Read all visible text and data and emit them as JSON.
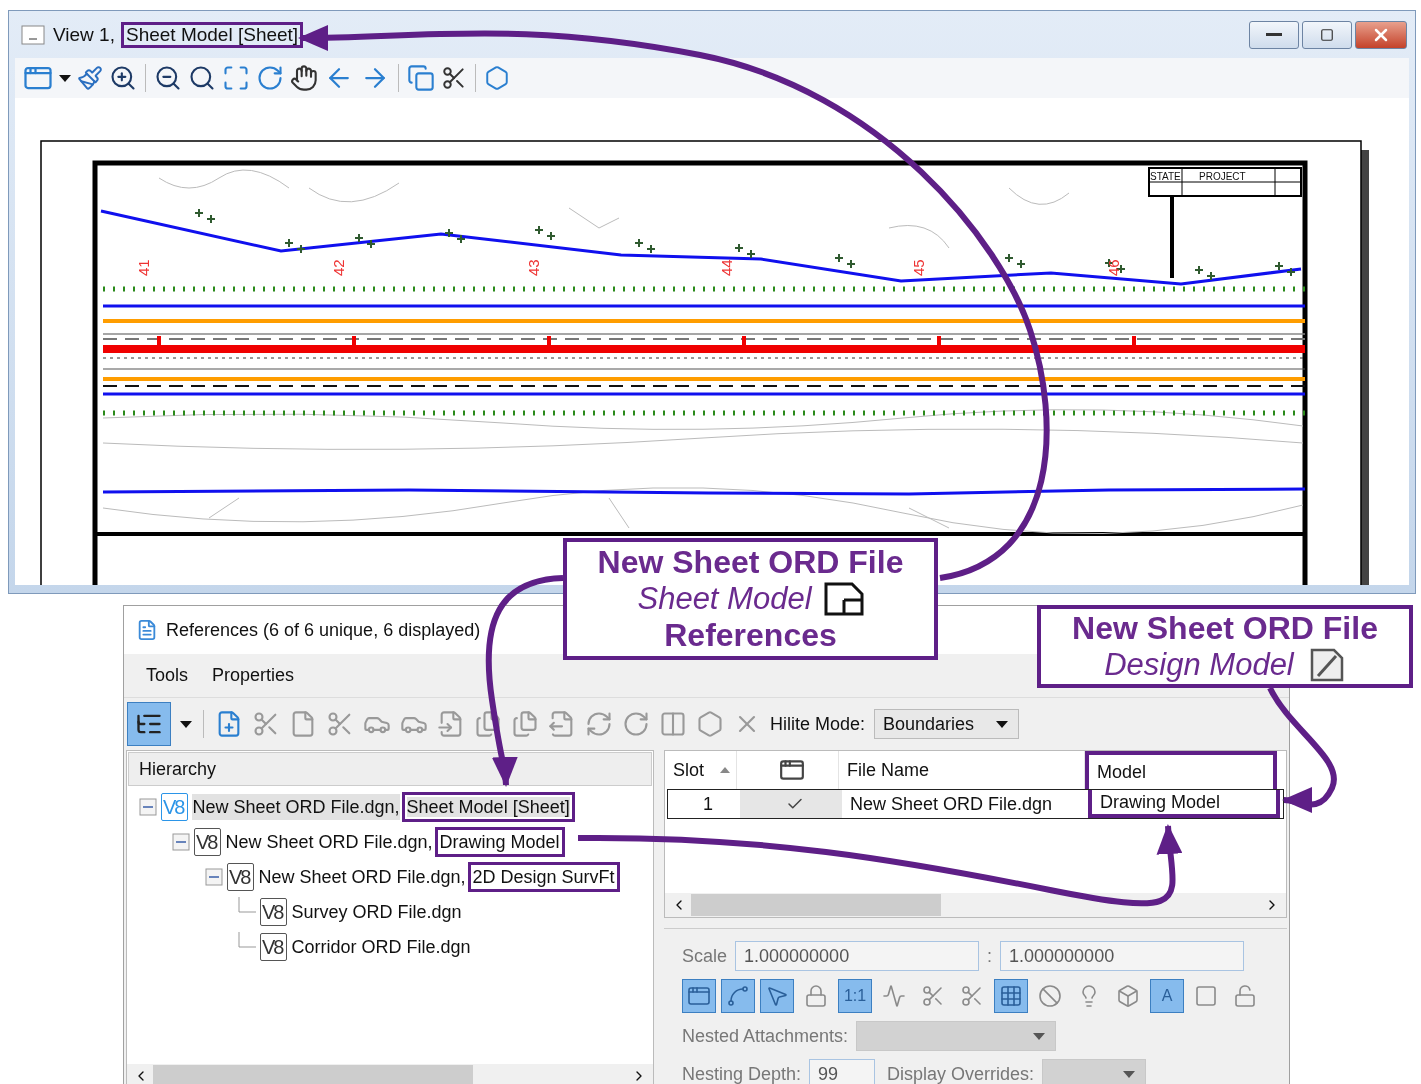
{
  "view_window": {
    "title": "View 1,",
    "title_model": "Sheet Model [Sheet]",
    "title_model_annotated": true,
    "sheet": {
      "stations": [
        "41",
        "42",
        "43",
        "44",
        "45",
        "46"
      ],
      "title_block": [
        "STATE",
        "PROJECT"
      ]
    }
  },
  "callouts": [
    {
      "kind": "sheet",
      "file": "New Sheet ORD File",
      "model": "Sheet Model",
      "caption": "References"
    },
    {
      "kind": "design",
      "file": "New Sheet ORD File",
      "model": "Design Model"
    }
  ],
  "references": {
    "title": "References (6 of 6 unique, 6 displayed)",
    "menu": [
      "Tools",
      "Properties"
    ],
    "view_toggle": {
      "on": true
    },
    "hilite_mode": {
      "label": "Hilite Mode:",
      "value": "Boundaries"
    },
    "hierarchy": {
      "heading": "Hierarchy",
      "tree": [
        {
          "format": "V8",
          "file": "New Sheet ORD File.dgn,",
          "model": "Sheet Model [Sheet]",
          "annotated": true,
          "selected": true,
          "expanded": true,
          "children": [
            {
              "format": "V8",
              "file": "New Sheet ORD File.dgn,",
              "model": "Drawing Model",
              "annotated": true,
              "selected": false,
              "expanded": true,
              "children": [
                {
                  "format": "V8",
                  "file": "New Sheet ORD File.dgn,",
                  "model": "2D Design SurvFt",
                  "annotated": true,
                  "selected": false,
                  "expanded": true,
                  "children": [
                    {
                      "format": "V8",
                      "file": "Survey ORD File.dgn",
                      "selected": false
                    },
                    {
                      "format": "V8",
                      "file": "Corridor ORD File.dgn",
                      "selected": false
                    }
                  ]
                }
              ]
            }
          ]
        }
      ]
    },
    "table": {
      "columns": [
        {
          "kind": "text",
          "label": "Slot",
          "sorted": true,
          "annotated": false
        },
        {
          "kind": "icon",
          "sorted": false,
          "annotated": false
        },
        {
          "kind": "text",
          "label": "File Name",
          "sorted": false,
          "annotated": false
        },
        {
          "kind": "text",
          "label": "Model",
          "sorted": false,
          "annotated": true
        }
      ],
      "rows": [
        {
          "slot": "1",
          "displayed": true,
          "file": "New Sheet ORD File.dgn",
          "model": "Drawing Model"
        }
      ]
    },
    "scale": {
      "label": "Scale",
      "separator": ":",
      "values": [
        "1.000000000",
        "1.000000000"
      ]
    },
    "display_toggles": [
      {
        "on": true
      },
      {
        "on": true
      },
      {
        "on": true
      },
      {
        "on": false
      },
      {
        "on": true,
        "label": "1:1"
      },
      {
        "on": false
      },
      {
        "on": false
      },
      {
        "on": false
      },
      {
        "on": true
      },
      {
        "on": false
      },
      {
        "on": false
      },
      {
        "on": false
      },
      {
        "on": true,
        "label": "A"
      },
      {
        "on": false
      },
      {
        "on": false
      }
    ],
    "nested_attachments": {
      "label": "Nested Attachments:",
      "disabled": true
    },
    "nesting_depth": {
      "label": "Nesting Depth:",
      "value": "99"
    },
    "display_overrides": {
      "label": "Display Overrides:",
      "disabled": true
    }
  }
}
